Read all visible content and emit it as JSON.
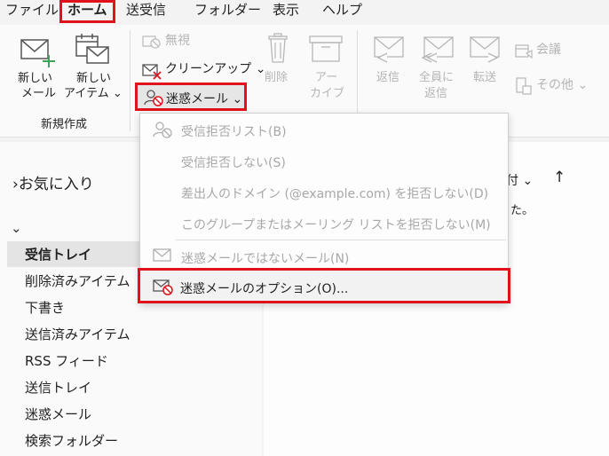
{
  "menu": {
    "tabs": [
      {
        "label": "ファイル"
      },
      {
        "label": "ホーム"
      },
      {
        "label": "送受信"
      },
      {
        "label": "フォルダー"
      },
      {
        "label": "表示"
      },
      {
        "label": "ヘルプ"
      }
    ]
  },
  "ribbon": {
    "new_mail": "新しい\nメール",
    "new_mail_l1": "新しい",
    "new_mail_l2": "メール",
    "new_item_l1": "新しい",
    "new_item_l2": "アイテム ⌄",
    "group_new": "新規作成",
    "ignore": "無視",
    "cleanup": "クリーンアップ ⌄",
    "junk": "迷惑メール ⌄",
    "delete": "削除",
    "archive_l1": "アー",
    "archive_l2": "カイブ",
    "reply": "返信",
    "reply_all_l1": "全員に",
    "reply_all_l2": "返信",
    "forward": "転送",
    "meeting": "会議",
    "more": "その他 ⌄"
  },
  "left": {
    "favorites": "お気に入り",
    "folders": [
      "受信トレイ",
      "削除済みアイテム",
      "下書き",
      "送信済みアイテム",
      "RSS フィード",
      "送信トレイ",
      "迷惑メール",
      "検索フォルダー"
    ]
  },
  "list": {
    "sort_partial": "付 ⌄",
    "sort_arrow": "↑",
    "message_partial": "た。"
  },
  "dropdown": {
    "items": [
      {
        "label": "受信拒否リスト(B)",
        "enabled": false
      },
      {
        "label": "受信拒否しない(S)",
        "enabled": false
      },
      {
        "label": "差出人のドメイン (@example.com) を拒否しない(D)",
        "enabled": false
      },
      {
        "label": "このグループまたはメーリング リストを拒否しない(M)",
        "enabled": false
      },
      {
        "label": "迷惑メールではないメール(N)",
        "enabled": false
      },
      {
        "label": "迷惑メールのオプション(O)...",
        "enabled": true
      }
    ]
  },
  "colors": {
    "highlight": "#e0121c",
    "accent_green": "#3aa655"
  }
}
